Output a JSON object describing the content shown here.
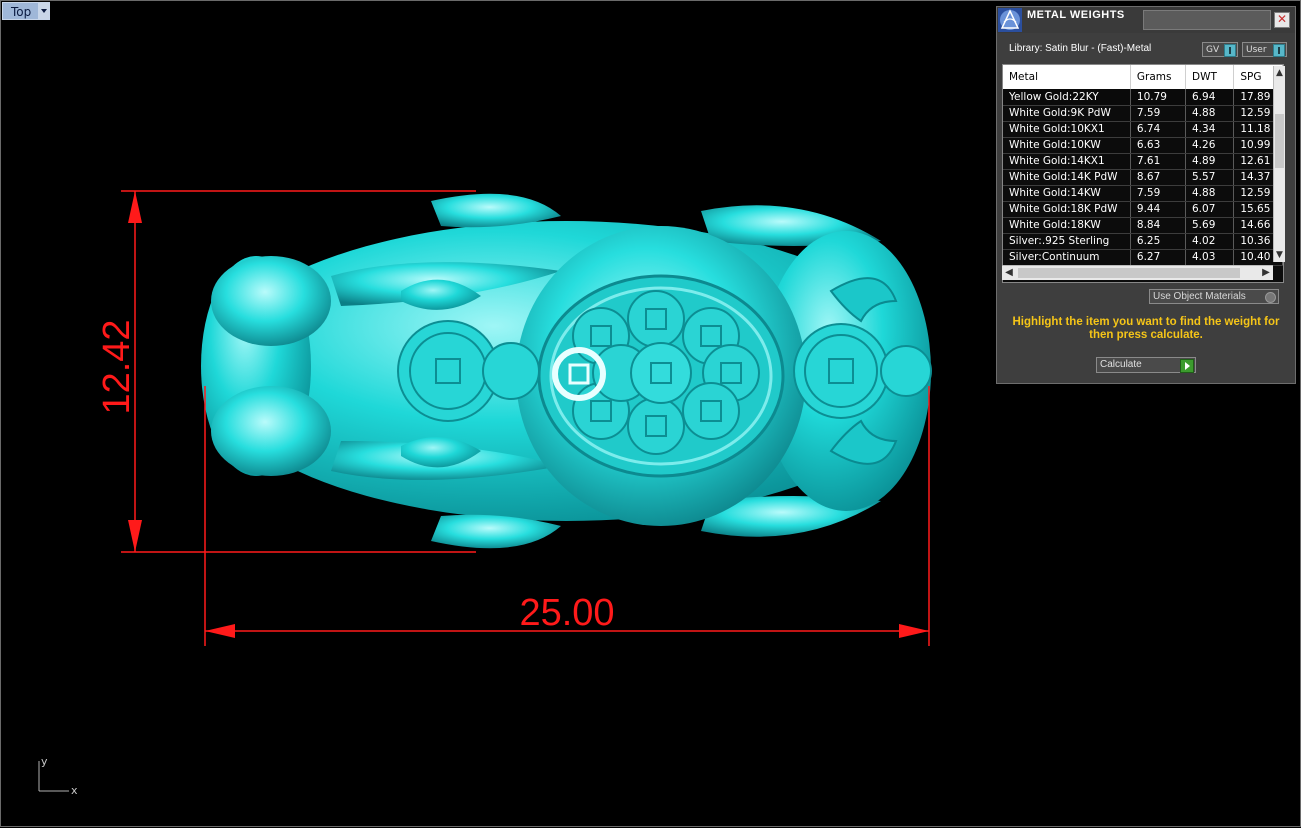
{
  "viewport": {
    "name": "Top",
    "dimensions": {
      "height_value": "12.42",
      "width_value": "25.00"
    },
    "axis": {
      "y_label": "y",
      "x_label": "x"
    },
    "colors": {
      "model": "#1fd8d8",
      "dimension": "#ff1a1a",
      "background": "#000000"
    }
  },
  "panel": {
    "title": "METAL WEIGHTS",
    "close_icon": "close-icon",
    "library": "Library: Satin Blur - (Fast)-Metal",
    "toggles": [
      {
        "label": "GV"
      },
      {
        "label": "User"
      }
    ],
    "columns": [
      "Metal",
      "Grams",
      "DWT",
      "SPG"
    ],
    "rows": [
      [
        "Yellow Gold:22KY",
        "10.79",
        "6.94",
        "17.89"
      ],
      [
        "White Gold:9K PdW",
        "7.59",
        "4.88",
        "12.59"
      ],
      [
        "White Gold:10KX1",
        "6.74",
        "4.34",
        "11.18"
      ],
      [
        "White Gold:10KW",
        "6.63",
        "4.26",
        "10.99"
      ],
      [
        "White Gold:14KX1",
        "7.61",
        "4.89",
        "12.61"
      ],
      [
        "White Gold:14K PdW",
        "8.67",
        "5.57",
        "14.37"
      ],
      [
        "White Gold:14KW",
        "7.59",
        "4.88",
        "12.59"
      ],
      [
        "White Gold:18K PdW",
        "9.44",
        "6.07",
        "15.65"
      ],
      [
        "White Gold:18KW",
        "8.84",
        "5.69",
        "14.66"
      ],
      [
        "Silver:.925 Sterling",
        "6.25",
        "4.02",
        "10.36"
      ],
      [
        "Silver:Continuum",
        "6.27",
        "4.03",
        "10.40"
      ]
    ],
    "use_object_materials": "Use Object Materials",
    "hint": "Highlight the item you want to find the weight for then press calculate.",
    "calculate": "Calculate",
    "colors": {
      "hint": "#f5c518",
      "toggle_knob": "#58b7c9",
      "calculate_go": "#3c9b2e"
    }
  }
}
